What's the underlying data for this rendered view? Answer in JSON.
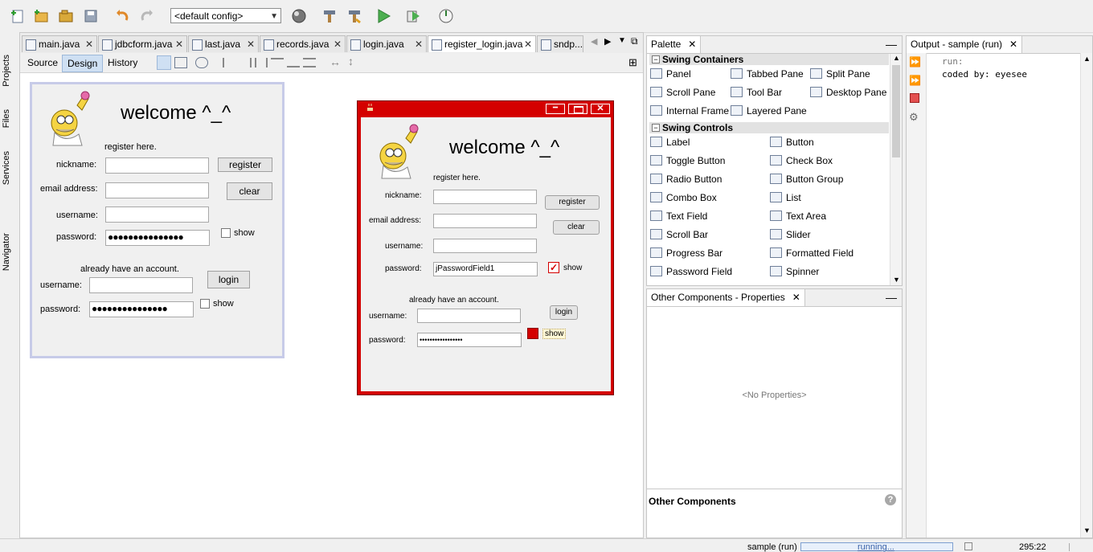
{
  "toolbar": {
    "config": "<default config>"
  },
  "left_strip": {
    "tabs": [
      "Projects",
      "Files",
      "Services",
      "Navigator"
    ]
  },
  "editor": {
    "tabs": [
      "main.java",
      "jdbcform.java",
      "last.java",
      "records.java",
      "login.java",
      "register_login.java",
      "sndp..."
    ],
    "active_tab": "register_login.java",
    "views": [
      "Source",
      "Design",
      "History"
    ],
    "active_view": "Design"
  },
  "form_design": {
    "title": "welcome ^_^",
    "register_hint": "register here.",
    "nickname_label": "nickname:",
    "email_label": "email address:",
    "username_label": "username:",
    "password_label": "password:",
    "password_value": "●●●●●●●●●●●●●●●",
    "register_btn": "register",
    "clear_btn": "clear",
    "show_label": "show",
    "account_hint": "already have an account.",
    "login_username_label": "username:",
    "login_password_label": "password:",
    "login_password_value": "●●●●●●●●●●●●●●●",
    "login_btn": "login",
    "login_show_label": "show"
  },
  "form_preview": {
    "title": "welcome ^_^",
    "register_hint": "register here.",
    "nickname_label": "nickname:",
    "email_label": "email address:",
    "username_label": "username:",
    "password_label": "password:",
    "password_value": "jPasswordField1",
    "register_btn": "register",
    "clear_btn": "clear",
    "show_label": "show",
    "account_hint": "already have an account.",
    "login_username_label": "username:",
    "login_password_label": "password:",
    "login_password_value": "•••••••••••••••••",
    "login_btn": "login",
    "login_show_label": "show",
    "accent": "#d40000"
  },
  "palette": {
    "title": "Palette",
    "containers_title": "Swing Containers",
    "containers": [
      "Panel",
      "Tabbed Pane",
      "Split Pane",
      "Scroll Pane",
      "Tool Bar",
      "Desktop Pane",
      "Internal Frame",
      "Layered Pane"
    ],
    "controls_title": "Swing Controls",
    "controls": [
      "Label",
      "Button",
      "Toggle Button",
      "Check Box",
      "Radio Button",
      "Button Group",
      "Combo Box",
      "List",
      "Text Field",
      "Text Area",
      "Scroll Bar",
      "Slider",
      "Progress Bar",
      "Formatted Field",
      "Password Field",
      "Spinner"
    ]
  },
  "properties": {
    "title": "Other Components - Properties",
    "empty": "<No Properties>",
    "footer": "Other Components"
  },
  "output": {
    "title": "Output - sample (run)",
    "lines": [
      "run:",
      "coded by: eyesee"
    ]
  },
  "status": {
    "task": "sample (run)",
    "progress": "running...",
    "position": "295:22"
  }
}
